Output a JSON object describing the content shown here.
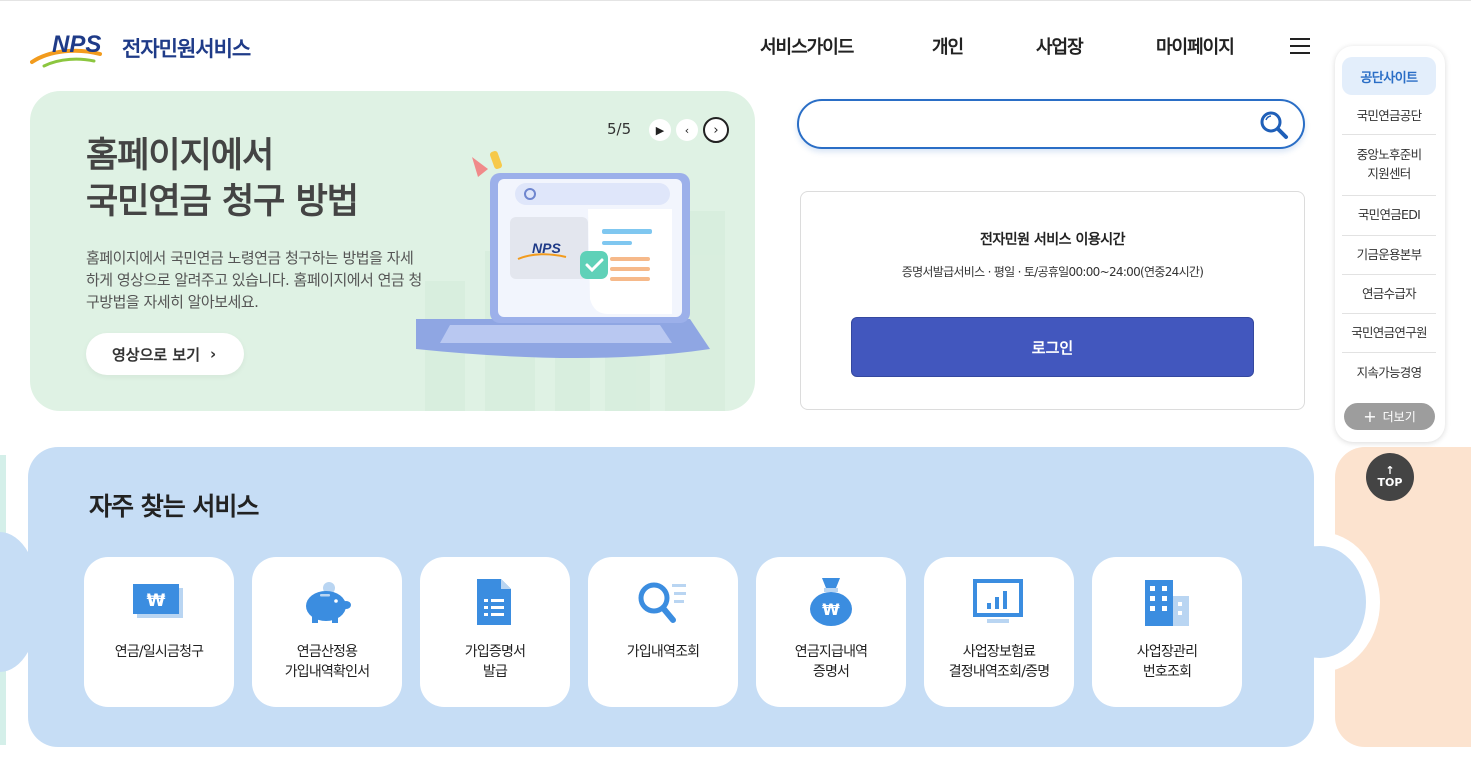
{
  "header": {
    "logo_text": "NPS",
    "service_name": "전자민원서비스",
    "nav": [
      "서비스가이드",
      "개인",
      "사업장",
      "마이페이지"
    ]
  },
  "banner": {
    "title_line1": "홈페이지에서",
    "title_line2": "국민연금 청구 방법",
    "description": "홈페이지에서 국민연금 노령연금 청구하는 방법을 자세하게 영상으로 알려주고 있습니다. 홈페이지에서 연금 청구방법을 자세히 알아보세요.",
    "button_label": "영상으로 보기",
    "pager": "5/5",
    "illustration_logo": "NPS"
  },
  "search": {
    "placeholder": "",
    "value": ""
  },
  "info": {
    "title": "전자민원 서비스 이용시간",
    "description": "증명서발급서비스 · 평일 · 토/공휴일00:00~24:00(연중24시간)",
    "login_label": "로그인"
  },
  "quick_menu": {
    "head": "공단사이트",
    "items": [
      "국민연금공단",
      "중앙노후준비\n지원센터",
      "국민연금EDI",
      "기금운용본부",
      "연금수급자",
      "국민연금연구원",
      "지속가능경영"
    ],
    "more_label": "더보기",
    "top_label": "TOP"
  },
  "services": {
    "title": "자주 찾는 서비스",
    "cards": [
      {
        "label": "연금/일시금청구",
        "icon": "won-bill-icon"
      },
      {
        "label": "연금산정용\n가입내역확인서",
        "icon": "piggy-bank-icon"
      },
      {
        "label": "가입증명서\n발급",
        "icon": "document-icon"
      },
      {
        "label": "가입내역조회",
        "icon": "magnifier-list-icon"
      },
      {
        "label": "연금지급내역\n증명서",
        "icon": "money-bag-icon"
      },
      {
        "label": "사업장보험료\n결정내역조회/증명",
        "icon": "monitor-chart-icon"
      },
      {
        "label": "사업장관리\n번호조회",
        "icon": "building-icon"
      }
    ]
  },
  "colors": {
    "brand_blue": "#1f3b88",
    "login_button": "#4257be",
    "search_border": "#2a6ec6",
    "banner_bg": "#dff2e4",
    "services_bg": "#c6ddf5",
    "icon_blue": "#3b8de0"
  }
}
